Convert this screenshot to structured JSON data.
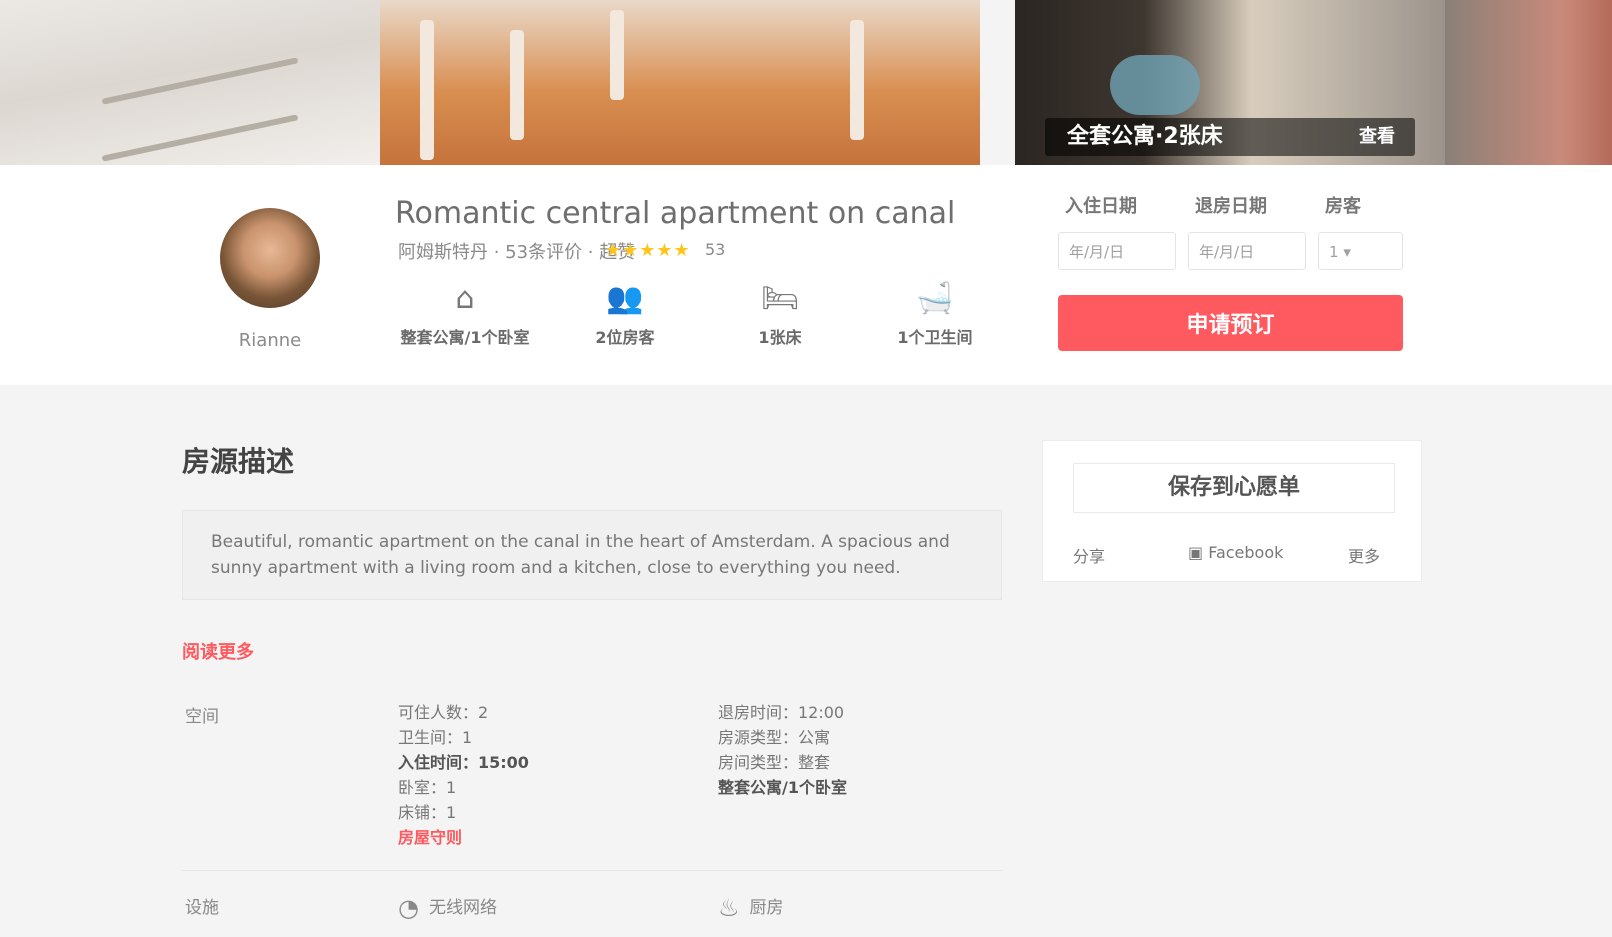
{
  "hero": {
    "caption": "全套公寓·2张床",
    "caption_right": "查看"
  },
  "host": {
    "name": "Rianne"
  },
  "listing": {
    "title": "Romantic central apartment on canal",
    "location": "阿姆斯特丹 · 53条评价 · 超赞",
    "stars": "★★★★★",
    "review_count": "53"
  },
  "features": [
    {
      "icon": "home-icon",
      "glyph": "⌂",
      "label": "整套公寓/1个卧室"
    },
    {
      "icon": "guests-icon",
      "glyph": "👥",
      "label": "2位房客"
    },
    {
      "icon": "bed-icon",
      "glyph": "🛏",
      "label": "1张床"
    },
    {
      "icon": "bath-icon",
      "glyph": "🛁",
      "label": "1个卫生间"
    }
  ],
  "booking": {
    "checkin_label": "入住日期",
    "checkout_label": "退房日期",
    "guests_label": "房客",
    "checkin_placeholder": "年/月/日",
    "checkout_placeholder": "年/月/日",
    "guests_value": "1",
    "book_button": "申请预订"
  },
  "about": {
    "title": "房源描述",
    "description": "Beautiful, romantic apartment on the canal in the heart of Amsterdam. A spacious and sunny apartment with a living room and a kitchen, close to everything you need.",
    "read_more": "阅读更多"
  },
  "details": {
    "label": "空间",
    "left": [
      "可住人数：2",
      "卫生间：1",
      "卧室：1",
      "床铺：1"
    ],
    "left_bold_line": "入住时间：15:00",
    "left_link": "房屋守则",
    "right": [
      "退房时间：12:00",
      "房源类型：公寓",
      "房间类型：整套"
    ],
    "right_bold": "整套公寓/1个卧室"
  },
  "amenities": {
    "label": "设施",
    "items": [
      {
        "icon": "wifi-icon",
        "glyph": "◔",
        "label": "无线网络"
      },
      {
        "icon": "kitchen-icon",
        "glyph": "♨",
        "label": "厨房"
      }
    ]
  },
  "side": {
    "title": "保存到心愿单",
    "share_label": "分享",
    "facebook_label": "Facebook",
    "more_label": "更多"
  }
}
